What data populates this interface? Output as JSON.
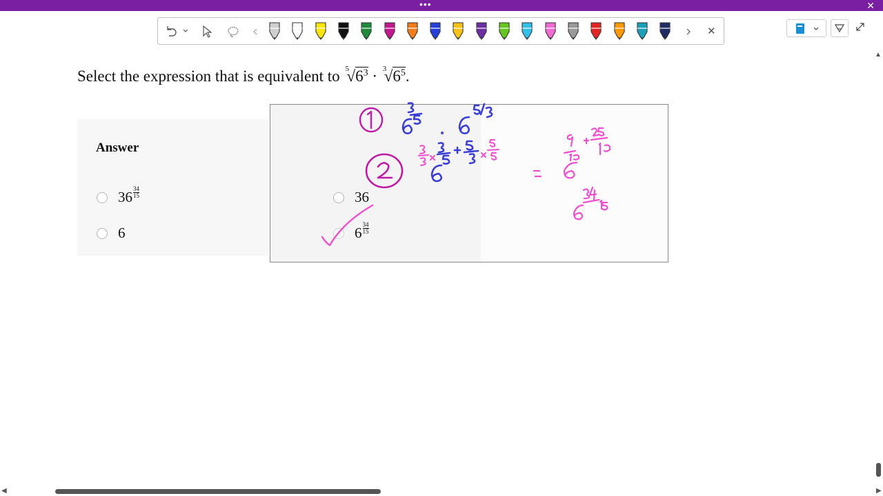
{
  "window": {
    "title_dots": "•••",
    "close": "✕"
  },
  "toolbar": {
    "undo_icon": "undo-icon",
    "more_icon": "chevron-down-icon",
    "select_icon": "cursor-icon",
    "lasso_icon": "lasso-icon",
    "prev_icon": "chevron-left-icon",
    "next_icon": "chevron-right-icon",
    "close_label": "✕",
    "pen_colors": [
      "#cfcfcf",
      "#ffffff",
      "#ffe600",
      "#111111",
      "#1f8a3b",
      "#c2188f",
      "#f07d1a",
      "#2540d9",
      "#f5c21a",
      "#6b2fa3",
      "#64c61e",
      "#33bfe8",
      "#f06ad2",
      "#9a9a9a",
      "#e42525",
      "#ff9900",
      "#1aa0b8",
      "#1f2c66"
    ]
  },
  "question": {
    "prefix": "Select the expression that is equivalent to ",
    "root1_index": "5",
    "root1_base": "6",
    "root1_exp": "3",
    "dot": " · ",
    "root2_index": "3",
    "root2_base": "6",
    "root2_exp": "5",
    "suffix": "."
  },
  "answer": {
    "title": "Answer",
    "options": [
      {
        "base": "36",
        "num": "34",
        "den": "15"
      },
      {
        "base": "6",
        "num": "",
        "den": ""
      },
      {
        "base": "36",
        "num": "",
        "den": ""
      },
      {
        "base": "6",
        "num": "34",
        "den": "15"
      }
    ]
  },
  "colors": {
    "purple_bar": "#7a1fa2",
    "ink_magenta": "#d21cc0",
    "ink_blue": "#3b3fd6",
    "ink_pink": "#f24fd0"
  }
}
